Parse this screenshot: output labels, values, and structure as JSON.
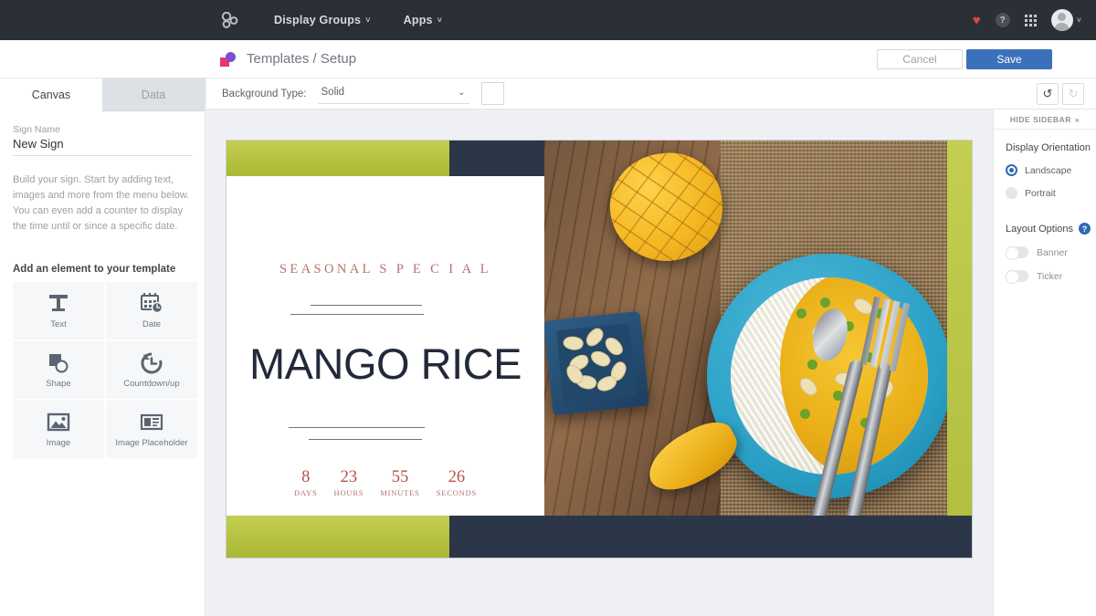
{
  "topnav": {
    "logo_icon": "appspace-logo-icon",
    "items": [
      {
        "label": "Display Groups",
        "chevron": "˅"
      },
      {
        "label": "Apps",
        "chevron": "˅"
      }
    ],
    "heart_icon": "♥",
    "help_label": "?",
    "avatar_chevron": "˅"
  },
  "breadcrumb": {
    "icon": "templates-icon",
    "text": "Templates / Setup",
    "cancel_label": "Cancel",
    "save_label": "Save",
    "save_color": "#3b71ba"
  },
  "left_panel": {
    "tabs": [
      {
        "label": "Canvas",
        "active": true
      },
      {
        "label": "Data",
        "active": false
      }
    ],
    "sign_name_label": "Sign Name",
    "sign_name_value": "New Sign",
    "sign_name_placeholder": "Sign Name",
    "help_text": "Build your sign. Start by adding text, images and more from the menu below. You can even add a counter to display the time until or since a specific date.",
    "add_element_label": "Add an element to your template",
    "tiles": [
      {
        "label": "Text",
        "icon": "text-t-icon"
      },
      {
        "label": "Date",
        "icon": "calendar-clock-icon"
      },
      {
        "label": "Shape",
        "icon": "square-circle-icon"
      },
      {
        "label": "Countdown/up",
        "icon": "clock-arrow-icon"
      },
      {
        "label": "Image",
        "icon": "image-icon"
      },
      {
        "label": "Image Placeholder",
        "icon": "image-placeholder-icon"
      }
    ]
  },
  "canvas_toolbar": {
    "background_type_label": "Background Type:",
    "background_type_value": "Solid",
    "chevron": "⌄",
    "swatch_color": "#ffffff",
    "undo_icon": "↺",
    "redo_icon": "↻"
  },
  "right_panel": {
    "hide_sidebar_label": "HIDE SIDEBAR",
    "hide_sidebar_chevron": "»",
    "orientation_title": "Display Orientation",
    "orientation_options": [
      {
        "label": "Landscape",
        "selected": true
      },
      {
        "label": "Portrait",
        "selected": false
      }
    ],
    "layout_options_title": "Layout Options",
    "layout_help_icon": "?",
    "toggles": [
      {
        "label": "Banner",
        "on": false
      },
      {
        "label": "Ticker",
        "on": false
      }
    ]
  },
  "sign": {
    "accent_olive": "#b8c442",
    "accent_navy": "#2b3648",
    "heading_kicker": "SEASONAL  S P E C I A L",
    "heading_title": "MANGO RICE",
    "countdown": [
      {
        "value": "8",
        "unit": "DAYS"
      },
      {
        "value": "23",
        "unit": "HOURS"
      },
      {
        "value": "55",
        "unit": "MINUTES"
      },
      {
        "value": "26",
        "unit": "SECONDS"
      }
    ],
    "photo_alt": "mango-rice-food-photo"
  }
}
